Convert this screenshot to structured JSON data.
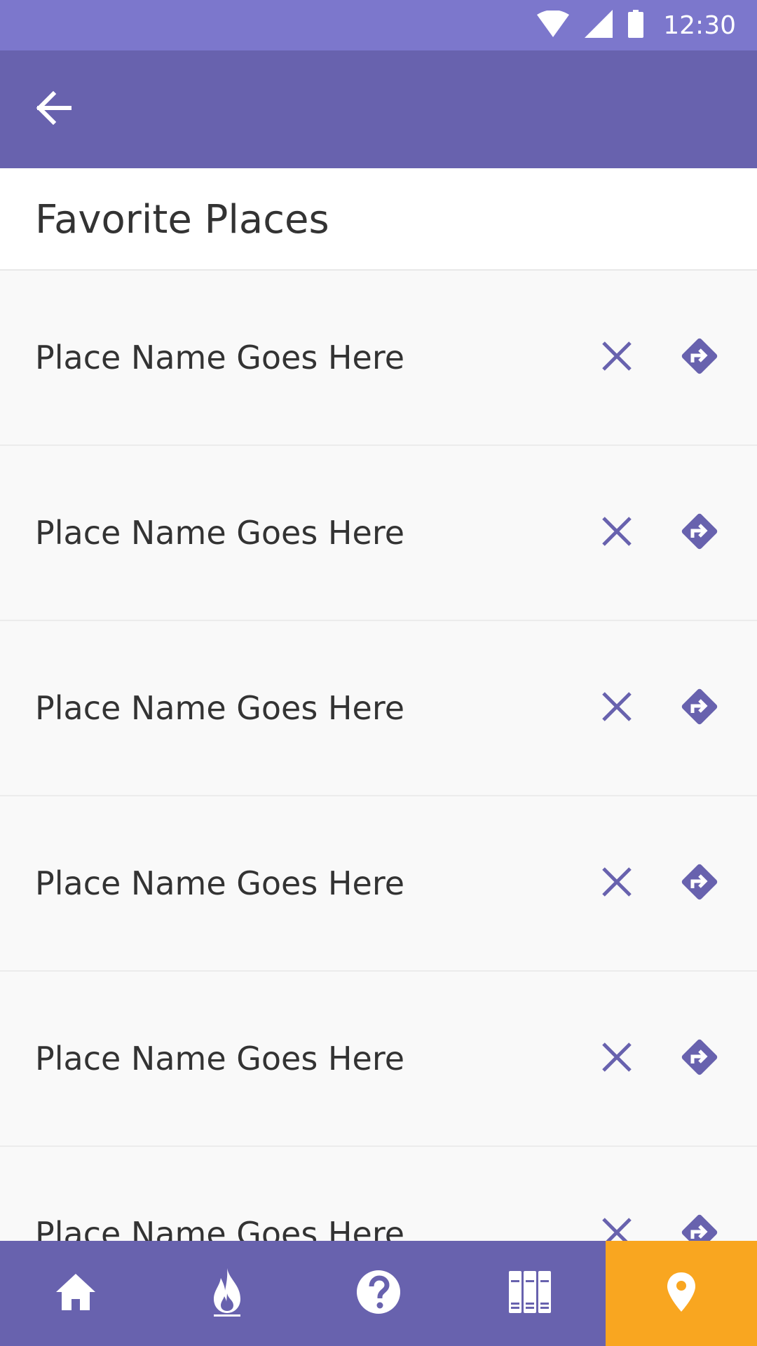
{
  "status_bar": {
    "time": "12:30",
    "icons": [
      "wifi-icon",
      "cellular-signal-icon",
      "battery-icon"
    ],
    "background": "#7c77cc"
  },
  "app_bar": {
    "back_icon": "arrow-back-icon",
    "background": "#6862ae"
  },
  "page": {
    "title": "Favorite Places"
  },
  "places": [
    {
      "name": "Place Name Goes Here"
    },
    {
      "name": "Place Name Goes Here"
    },
    {
      "name": "Place Name Goes Here"
    },
    {
      "name": "Place Name Goes Here"
    },
    {
      "name": "Place Name Goes Here"
    },
    {
      "name": "Place Name Goes Here"
    }
  ],
  "row_actions": {
    "remove_icon": "close-icon",
    "directions_icon": "directions-icon",
    "icon_color": "#6862ae"
  },
  "bottom_nav": {
    "items": [
      {
        "icon": "home-icon",
        "active": false
      },
      {
        "icon": "fire-icon",
        "active": false
      },
      {
        "icon": "help-icon",
        "active": false
      },
      {
        "icon": "library-icon",
        "active": false
      },
      {
        "icon": "location-pin-icon",
        "active": true
      }
    ],
    "background": "#6862ae",
    "active_color": "#f9a620"
  }
}
